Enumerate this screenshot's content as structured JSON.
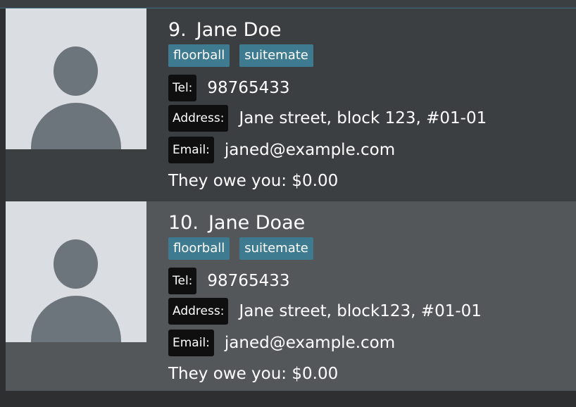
{
  "persons": [
    {
      "index": "9.",
      "name": "Jane Doe",
      "tags": [
        "floorball",
        "suitemate"
      ],
      "tel_label": "Tel:",
      "tel": "98765433",
      "address_label": "Address:",
      "address": "Jane street, block 123, #01-01",
      "email_label": "Email:",
      "email": "janed@example.com",
      "owe": "They owe you: $0.00"
    },
    {
      "index": "10.",
      "name": "Jane Doae",
      "tags": [
        "floorball",
        "suitemate"
      ],
      "tel_label": "Tel:",
      "tel": "98765433",
      "address_label": "Address:",
      "address": "Jane street, block123, #01-01",
      "email_label": "Email:",
      "email": "janed@example.com",
      "owe": "They owe you: $0.00"
    }
  ],
  "colors": {
    "card_odd": "#3c3f41",
    "card_even": "#53575a",
    "tag": "#3e7b91",
    "label_bg": "#0f0f10",
    "avatar_bg": "#dadde1",
    "avatar_fg": "#6d757c"
  }
}
